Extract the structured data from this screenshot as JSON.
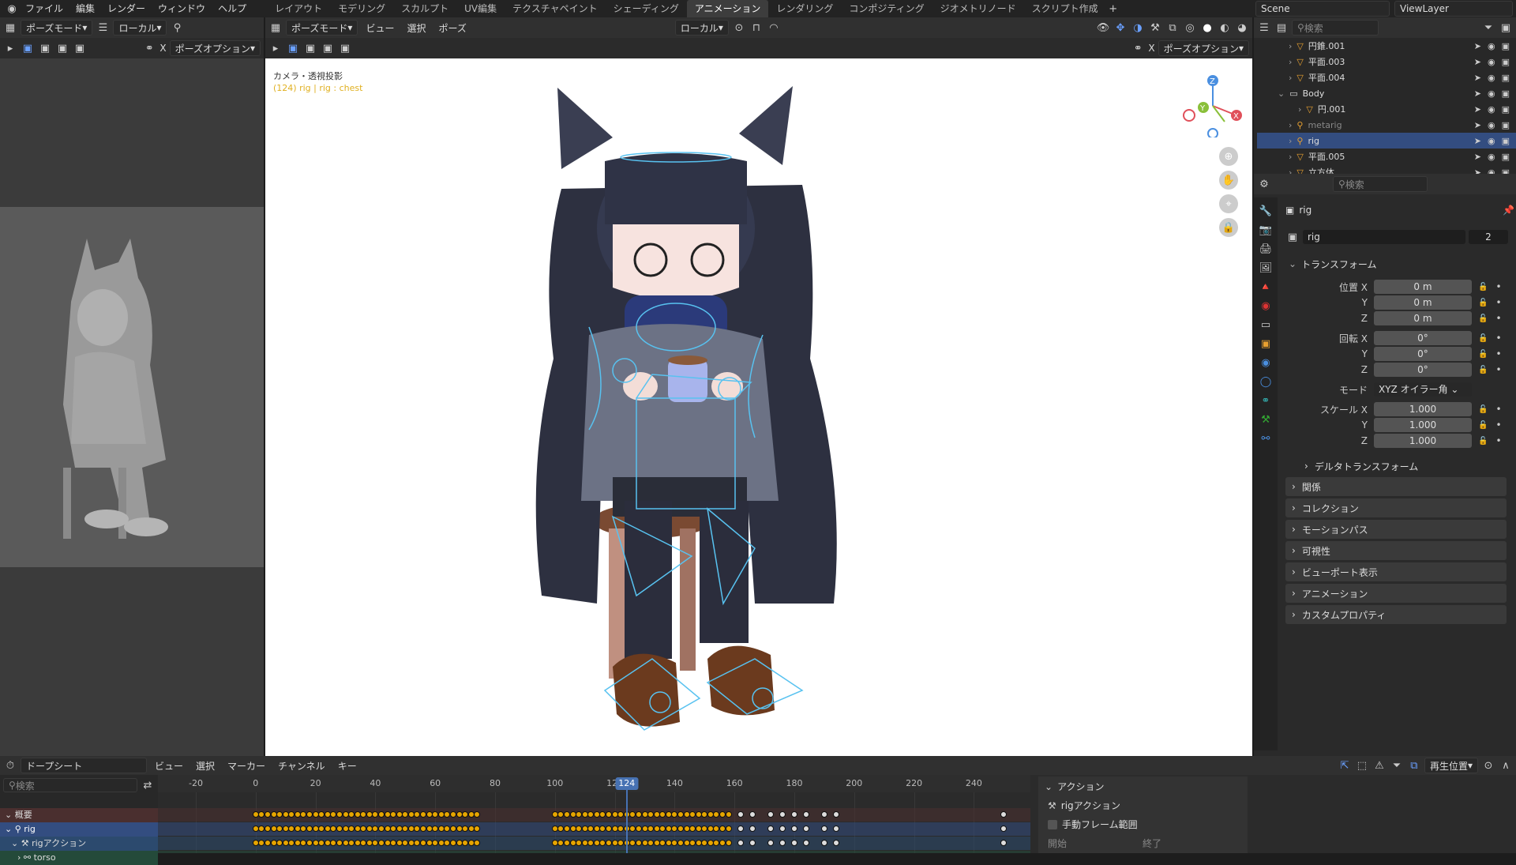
{
  "menu": [
    "ファイル",
    "編集",
    "レンダー",
    "ウィンドウ",
    "ヘルプ"
  ],
  "workspaces": [
    "レイアウト",
    "モデリング",
    "スカルプト",
    "UV編集",
    "テクスチャペイント",
    "シェーディング",
    "アニメーション",
    "レンダリング",
    "コンポジティング",
    "ジオメトリノード",
    "スクリプト作成"
  ],
  "active_workspace": "アニメーション",
  "scene": {
    "label": "Scene",
    "viewlayer": "ViewLayer"
  },
  "left_header": {
    "mode": "ポーズモード",
    "orient": "ローカル",
    "options": "ポーズオプション",
    "x_label": "X"
  },
  "viewport_header": {
    "mode": "ポーズモード",
    "menus": [
      "ビュー",
      "選択",
      "ポーズ"
    ],
    "orient": "ローカル",
    "options": "ポーズオプション",
    "x_label": "X"
  },
  "viewport": {
    "camera_text": "カメラ・透視投影",
    "context_text": "(124) rig | rig : chest"
  },
  "gizmo": {
    "z": "Z",
    "y": "Y",
    "x": "X"
  },
  "outliner": {
    "search_placeholder": "検索",
    "rows": [
      {
        "name": "円錐.001",
        "type": "mesh"
      },
      {
        "name": "平面.003",
        "type": "mesh"
      },
      {
        "name": "平面.004",
        "type": "mesh"
      },
      {
        "name": "Body",
        "type": "collection"
      },
      {
        "name": "円.001",
        "type": "mesh"
      },
      {
        "name": "metarig",
        "type": "armature"
      },
      {
        "name": "rig",
        "type": "armature",
        "selected": true
      },
      {
        "name": "平面.005",
        "type": "mesh"
      },
      {
        "name": "立方体",
        "type": "mesh"
      }
    ]
  },
  "properties": {
    "search_placeholder": "検索",
    "object_name": "rig",
    "data_name": "rig",
    "users": "2",
    "transform_label": "トランスフォーム",
    "loc_label": "位置 X",
    "rot_label": "回転 X",
    "scale_label": "スケール X",
    "y": "Y",
    "z": "Z",
    "loc": [
      "0 m",
      "0 m",
      "0 m"
    ],
    "rot": [
      "0°",
      "0°",
      "0°"
    ],
    "mode_label": "モード",
    "mode_value": "XYZ オイラー角",
    "scale": [
      "1.000",
      "1.000",
      "1.000"
    ],
    "sections": [
      "デルタトランスフォーム",
      "関係",
      "コレクション",
      "モーションパス",
      "可視性",
      "ビューポート表示",
      "アニメーション",
      "カスタムプロパティ"
    ]
  },
  "dopesheet": {
    "editor": "ドープシート",
    "menus": [
      "ビュー",
      "選択",
      "マーカー",
      "チャンネル",
      "キー"
    ],
    "playback": "再生位置",
    "search_placeholder": "検索",
    "ticks": [
      "-20",
      "0",
      "20",
      "40",
      "60",
      "80",
      "100",
      "120",
      "140",
      "160",
      "180",
      "200",
      "220",
      "240"
    ],
    "current_frame": "124",
    "channels": [
      "概要",
      "rig",
      "rigアクション",
      "torso"
    ],
    "action_panel": {
      "title": "アクション",
      "action": "rigアクション",
      "manual_range": "手動フレーム範囲",
      "start": "開始",
      "end": "終了"
    }
  },
  "colors": {
    "accent": "#4772b3",
    "keyframe": "#e6a500",
    "selected_row": "#334d80"
  }
}
